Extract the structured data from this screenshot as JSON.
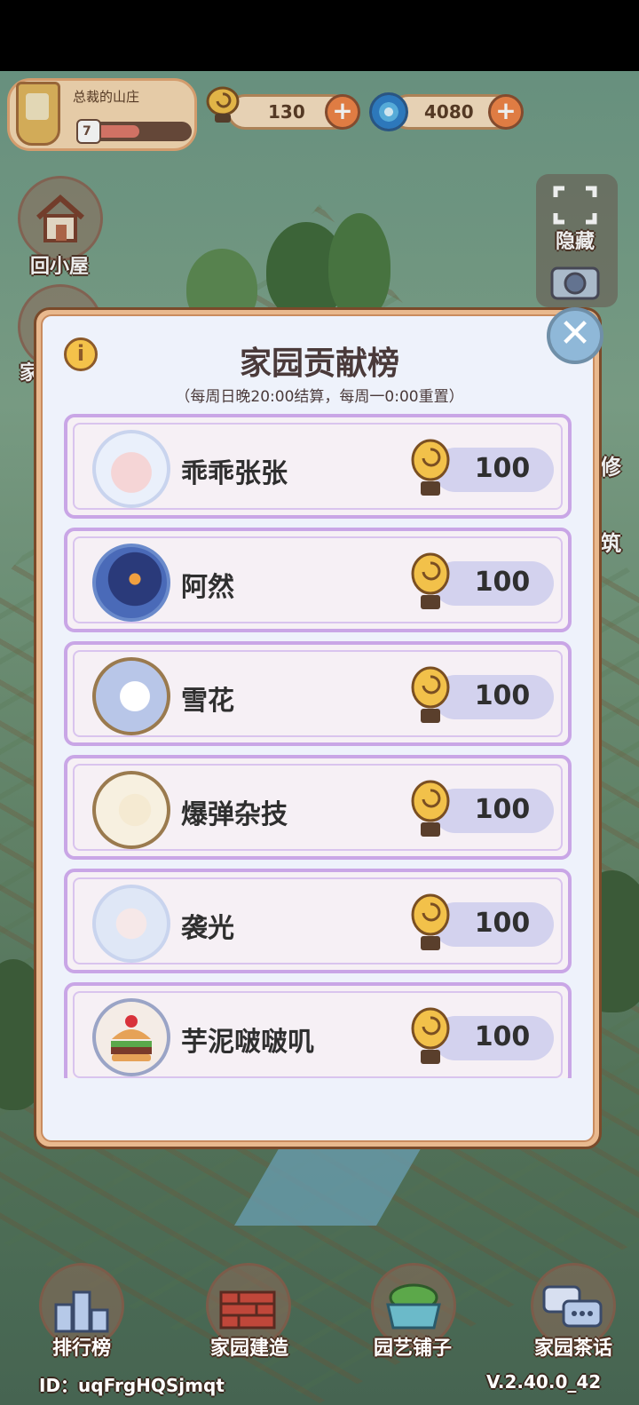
{
  "manor": {
    "title": "总裁的山庄",
    "level": "7",
    "level_progress": 0.55
  },
  "currency": {
    "snail_coins": "130",
    "gems": "4080"
  },
  "side_buttons": {
    "back_home": "回小屋",
    "left_partial": "家",
    "hide": "隐藏",
    "photo_partial": "拍照",
    "right_partial_1": "修",
    "right_partial_2": "筑"
  },
  "modal": {
    "title": "家园贡献榜",
    "subtitle": "（每周日晚20:00结算，每周一0:00重置）",
    "entries": [
      {
        "name": "乖乖张张",
        "score": "100"
      },
      {
        "name": "阿然",
        "score": "100"
      },
      {
        "name": "雪花",
        "score": "100"
      },
      {
        "name": "爆弹杂技",
        "score": "100"
      },
      {
        "name": "袭光",
        "score": "100"
      },
      {
        "name": "芋泥啵啵叽",
        "score": "100"
      }
    ]
  },
  "bottom_nav": {
    "ranking": "排行榜",
    "build": "家园建造",
    "shop": "园艺铺子",
    "chat": "家园茶话"
  },
  "footer": {
    "id_text": "ID：uqFrgHQSjmqt",
    "version": "V.2.40.0_42"
  }
}
